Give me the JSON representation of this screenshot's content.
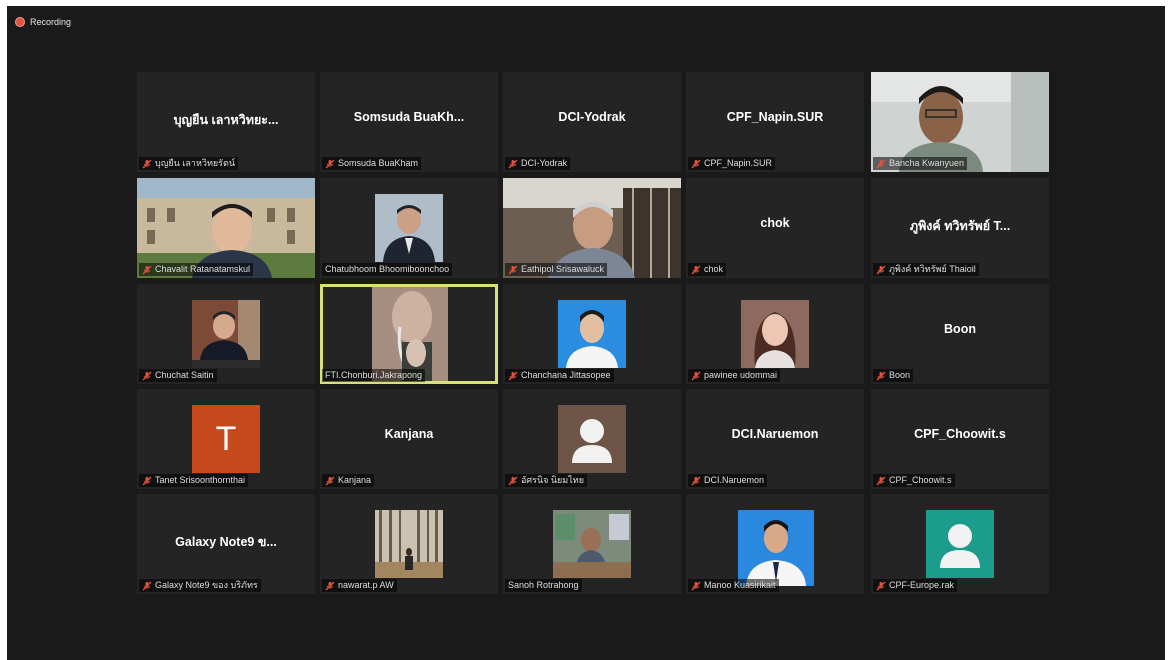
{
  "recording": {
    "label": "Recording"
  },
  "tiles": [
    {
      "name": "บุญยืน เลาหวิทยะ...",
      "label": "บุญยืน เลาหวิทยรัตน์",
      "muted": true
    },
    {
      "name": "Somsuda  BuaKh...",
      "label": "Somsuda BuaKham",
      "muted": true
    },
    {
      "name": "DCI-Yodrak",
      "label": "DCI-Yodrak",
      "muted": true
    },
    {
      "name": "CPF_Napin.SUR",
      "label": "CPF_Napin.SUR",
      "muted": true
    },
    {
      "name": "",
      "label": "Bancha Kwanyuen",
      "muted": true
    },
    {
      "name": "",
      "label": "Chavalit Ratanatamskul",
      "muted": true
    },
    {
      "name": "",
      "label": "Chatubhoom Bhoomiboonchoo",
      "muted": false
    },
    {
      "name": "",
      "label": "Eathipol Srisawaluck",
      "muted": true
    },
    {
      "name": "chok",
      "label": "chok",
      "muted": true
    },
    {
      "name": "ภูพิงค์ ทวิทรัพย์ T...",
      "label": "ภูพิงค์ ทวิทรัพย์ Thaioil",
      "muted": true
    },
    {
      "name": "",
      "label": "Chuchat Saitin",
      "muted": true
    },
    {
      "name": "",
      "label": "FTI.Chonburi.Jakrapong",
      "muted": false
    },
    {
      "name": "",
      "label": "Chanchana Jittasopee",
      "muted": true
    },
    {
      "name": "",
      "label": "pawinee udommai",
      "muted": true
    },
    {
      "name": "Boon",
      "label": "Boon",
      "muted": true
    },
    {
      "name": "",
      "label": "Tanet Srisoonthornthai",
      "muted": true,
      "avatar": "T"
    },
    {
      "name": "Kanjana",
      "label": "Kanjana",
      "muted": true
    },
    {
      "name": "",
      "label": "อัศรนิจ นิยมไทย",
      "muted": true
    },
    {
      "name": "DCI.Naruemon",
      "label": "DCI.Naruemon",
      "muted": true
    },
    {
      "name": "CPF_Choowit.s",
      "label": "CPF_Choowit.s",
      "muted": true
    },
    {
      "name": "Galaxy  Note9 ข...",
      "label": "Galaxy Note9 ของ บริภัทร",
      "muted": true
    },
    {
      "name": "",
      "label": "nawarat.p AW",
      "muted": true
    },
    {
      "name": "",
      "label": "Sanoh Rotrahong",
      "muted": false
    },
    {
      "name": "",
      "label": "Manoo Kuasirikait",
      "muted": true
    },
    {
      "name": "",
      "label": "CPF-Europe.rak",
      "muted": true
    }
  ],
  "colors": {
    "active_speaker": "#d8e07a",
    "muted_icon": "#e0533d",
    "record": "#e0533d"
  }
}
